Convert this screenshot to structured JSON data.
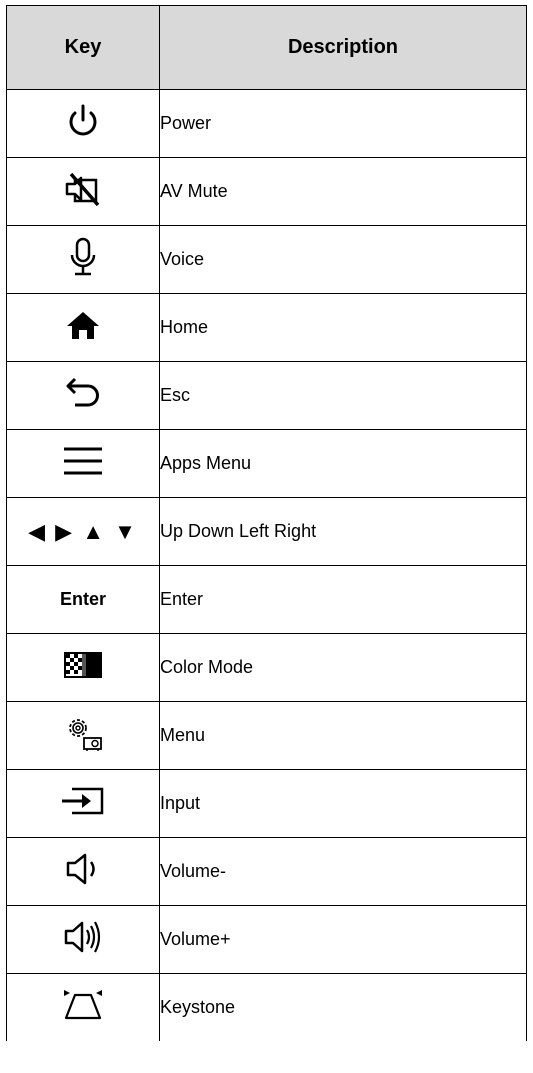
{
  "table": {
    "header": {
      "key": "Key",
      "description": "Description"
    },
    "rows": [
      {
        "icon": "power-icon",
        "description": "Power"
      },
      {
        "icon": "av-mute-icon",
        "description": "AV Mute"
      },
      {
        "icon": "microphone-icon",
        "description": "Voice"
      },
      {
        "icon": "home-icon",
        "description": "Home"
      },
      {
        "icon": "back-arrow-icon",
        "description": "Esc"
      },
      {
        "icon": "hamburger-menu-icon",
        "description": "Apps Menu"
      },
      {
        "icon": "direction-arrows-icon",
        "key_text": "◀ ▶ ▲ ▼",
        "description": "Up Down Left Right"
      },
      {
        "key_text": "Enter",
        "description": "Enter"
      },
      {
        "icon": "color-mode-icon",
        "description": "Color Mode"
      },
      {
        "icon": "settings-projector-icon",
        "description": "Menu"
      },
      {
        "icon": "input-source-icon",
        "description": "Input"
      },
      {
        "icon": "volume-down-icon",
        "description": "Volume-"
      },
      {
        "icon": "volume-up-icon",
        "description": "Volume+"
      },
      {
        "icon": "keystone-icon",
        "description": "Keystone"
      }
    ]
  }
}
